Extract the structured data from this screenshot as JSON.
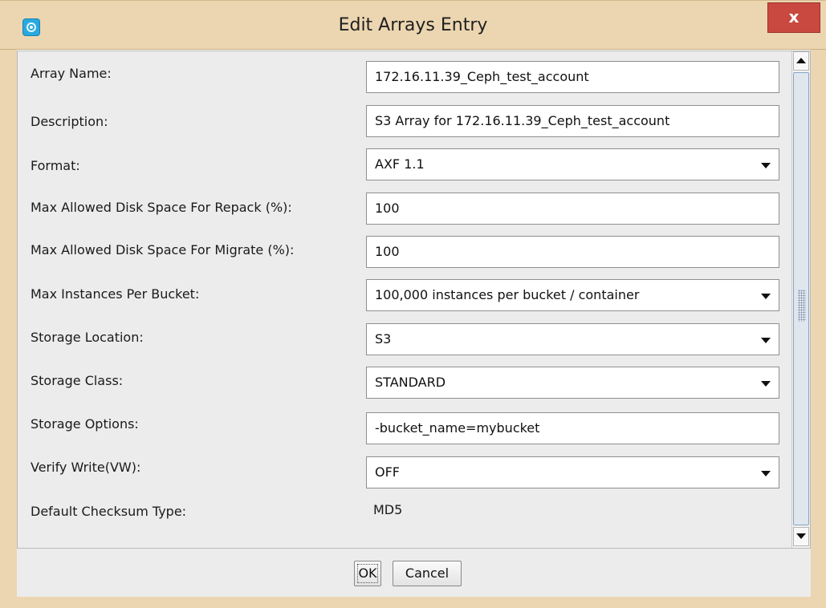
{
  "window": {
    "title": "Edit Arrays Entry",
    "close_label": "x",
    "icon": "app-disc-icon",
    "accent_color": "#ecd6b1",
    "close_color": "#c9483f"
  },
  "form": {
    "array_name": {
      "label": "Array Name:",
      "value": "172.16.11.39_Ceph_test_account"
    },
    "description": {
      "label": "Description:",
      "value": "S3 Array for 172.16.11.39_Ceph_test_account"
    },
    "format": {
      "label": "Format:",
      "value": "AXF 1.1"
    },
    "repack": {
      "label": "Max Allowed Disk Space For Repack (%):",
      "value": "100"
    },
    "migrate": {
      "label": "Max Allowed Disk Space For Migrate (%):",
      "value": "100"
    },
    "max_instances": {
      "label": "Max Instances Per Bucket:",
      "value": "100,000 instances per bucket / container"
    },
    "storage_location": {
      "label": "Storage Location:",
      "value": "S3"
    },
    "storage_class": {
      "label": "Storage Class:",
      "value": "STANDARD"
    },
    "storage_options": {
      "label": "Storage Options:",
      "value": "-bucket_name=mybucket"
    },
    "verify_write": {
      "label": "Verify Write(VW):",
      "value": "OFF"
    },
    "checksum": {
      "label": "Default Checksum Type:",
      "value": "MD5"
    }
  },
  "buttons": {
    "ok": "OK",
    "cancel": "Cancel"
  }
}
